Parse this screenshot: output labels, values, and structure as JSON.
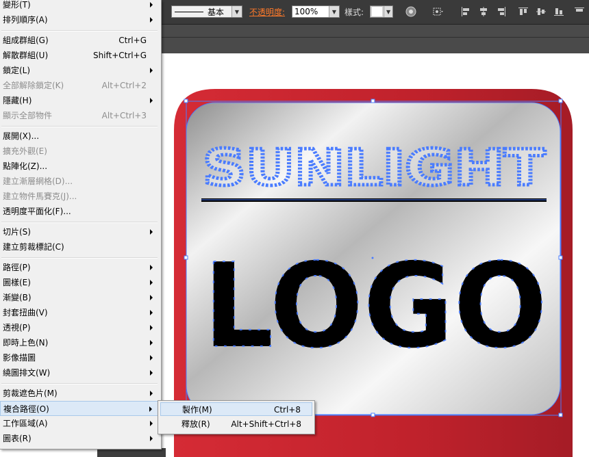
{
  "control_bar": {
    "stroke_profile_label": "基本",
    "opacity_label": "不透明度:",
    "opacity_value": "100%",
    "style_label": "樣式:"
  },
  "artwork": {
    "top_text": "SUNLIGHT",
    "main_text": "LOGO",
    "colors": {
      "frame": "#c0222c",
      "panel_light": "#ffffff",
      "panel_dark": "#909090",
      "selection": "#4a7cff",
      "text": "#000000"
    }
  },
  "menu": {
    "items": [
      {
        "label": "變形(T)",
        "shortcut": "",
        "submenu": true,
        "disabled": false
      },
      {
        "label": "排列順序(A)",
        "shortcut": "",
        "submenu": true,
        "disabled": false
      },
      {
        "label": "組成群組(G)",
        "shortcut": "Ctrl+G",
        "submenu": false,
        "disabled": false
      },
      {
        "label": "解散群組(U)",
        "shortcut": "Shift+Ctrl+G",
        "submenu": false,
        "disabled": false
      },
      {
        "label": "鎖定(L)",
        "shortcut": "",
        "submenu": true,
        "disabled": false
      },
      {
        "label": "全部解除鎖定(K)",
        "shortcut": "Alt+Ctrl+2",
        "submenu": false,
        "disabled": true
      },
      {
        "label": "隱藏(H)",
        "shortcut": "",
        "submenu": true,
        "disabled": false
      },
      {
        "label": "顯示全部物件",
        "shortcut": "Alt+Ctrl+3",
        "submenu": false,
        "disabled": true
      },
      {
        "label": "展開(X)...",
        "shortcut": "",
        "submenu": false,
        "disabled": false
      },
      {
        "label": "擴充外觀(E)",
        "shortcut": "",
        "submenu": false,
        "disabled": true
      },
      {
        "label": "點陣化(Z)...",
        "shortcut": "",
        "submenu": false,
        "disabled": false
      },
      {
        "label": "建立漸層網格(D)...",
        "shortcut": "",
        "submenu": false,
        "disabled": true
      },
      {
        "label": "建立物件馬賽克(J)...",
        "shortcut": "",
        "submenu": false,
        "disabled": true
      },
      {
        "label": "透明度平面化(F)...",
        "shortcut": "",
        "submenu": false,
        "disabled": false
      },
      {
        "label": "切片(S)",
        "shortcut": "",
        "submenu": true,
        "disabled": false
      },
      {
        "label": "建立剪裁標記(C)",
        "shortcut": "",
        "submenu": false,
        "disabled": false
      },
      {
        "label": "路徑(P)",
        "shortcut": "",
        "submenu": true,
        "disabled": false
      },
      {
        "label": "圖樣(E)",
        "shortcut": "",
        "submenu": true,
        "disabled": false
      },
      {
        "label": "漸變(B)",
        "shortcut": "",
        "submenu": true,
        "disabled": false
      },
      {
        "label": "封套扭曲(V)",
        "shortcut": "",
        "submenu": true,
        "disabled": false
      },
      {
        "label": "透視(P)",
        "shortcut": "",
        "submenu": true,
        "disabled": false
      },
      {
        "label": "即時上色(N)",
        "shortcut": "",
        "submenu": true,
        "disabled": false
      },
      {
        "label": "影像描圖",
        "shortcut": "",
        "submenu": true,
        "disabled": false
      },
      {
        "label": "繞圖排文(W)",
        "shortcut": "",
        "submenu": true,
        "disabled": false
      },
      {
        "label": "剪裁遮色片(M)",
        "shortcut": "",
        "submenu": true,
        "disabled": false
      },
      {
        "label": "複合路徑(O)",
        "shortcut": "",
        "submenu": true,
        "disabled": false
      },
      {
        "label": "工作區域(A)",
        "shortcut": "",
        "submenu": true,
        "disabled": false
      },
      {
        "label": "圖表(R)",
        "shortcut": "",
        "submenu": true,
        "disabled": false
      }
    ]
  },
  "submenu": {
    "items": [
      {
        "label": "製作(M)",
        "shortcut": "Ctrl+8"
      },
      {
        "label": "釋放(R)",
        "shortcut": "Alt+Shift+Ctrl+8"
      }
    ]
  }
}
